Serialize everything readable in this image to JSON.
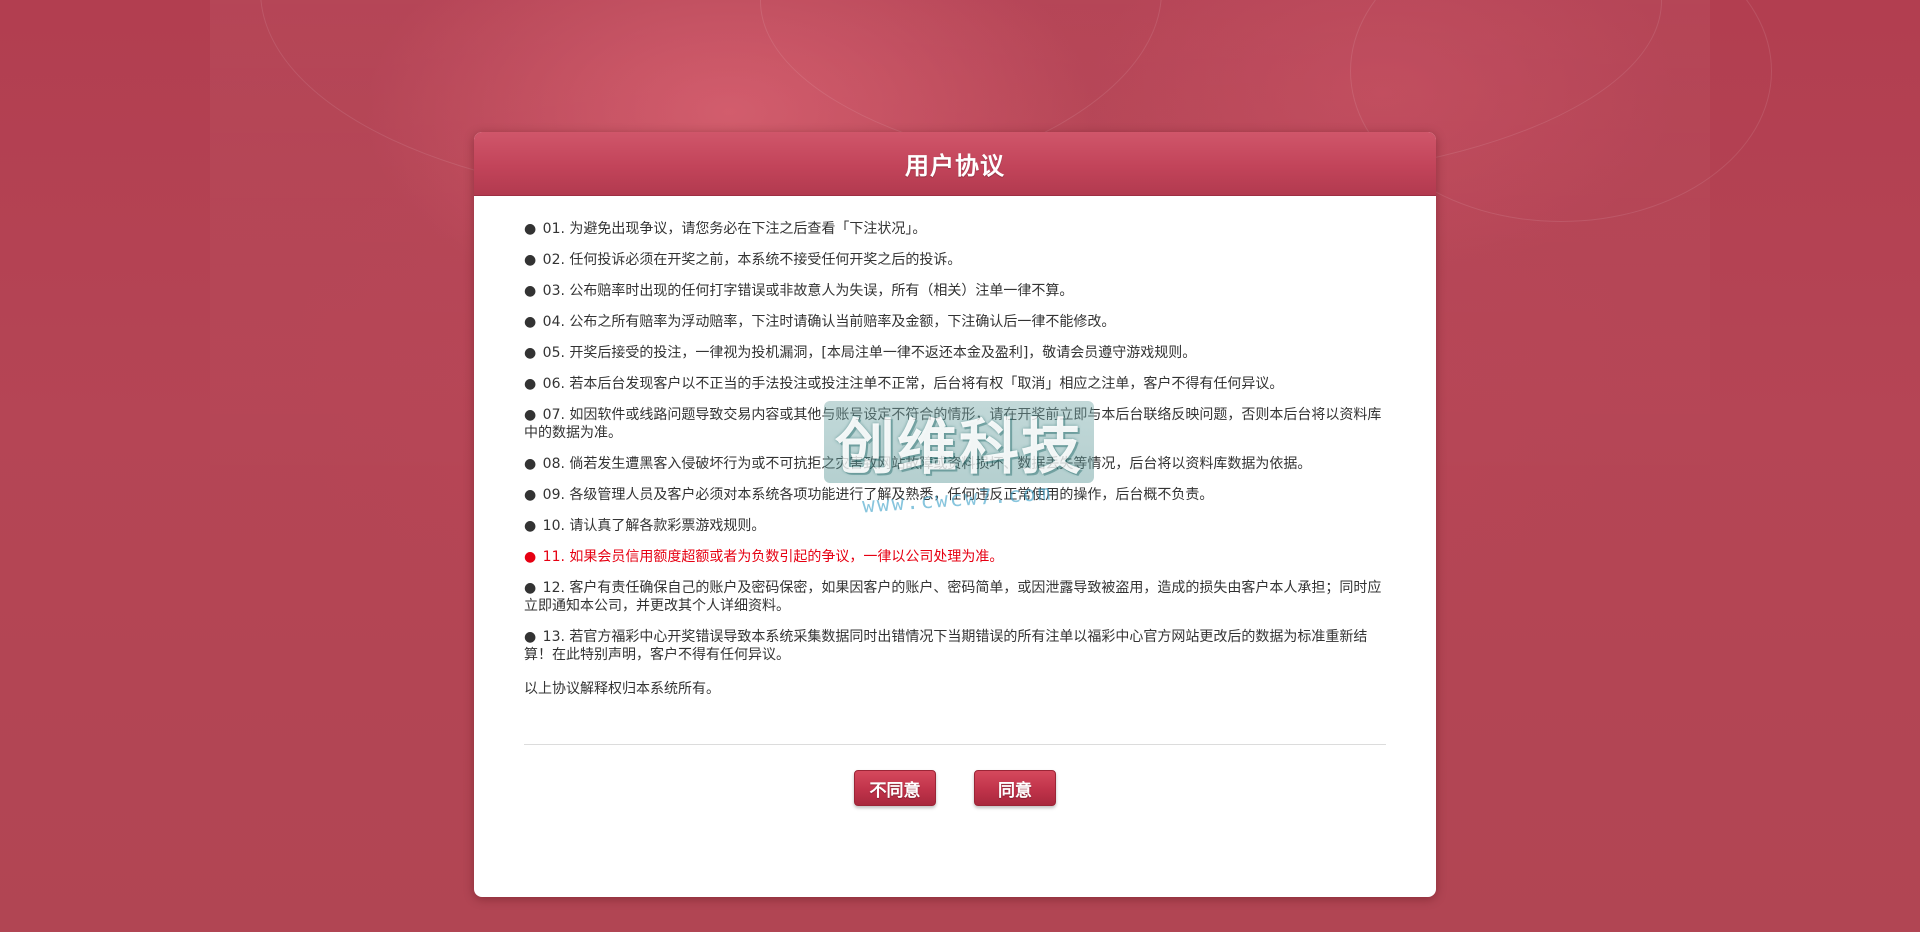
{
  "dialog": {
    "title": "用户协议"
  },
  "terms": [
    {
      "bullet": "●",
      "text": "01. 为避免出现争议，请您务必在下注之后查看「下注状况」。",
      "highlight": false
    },
    {
      "bullet": "●",
      "text": "02. 任何投诉必须在开奖之前，本系统不接受任何开奖之后的投诉。",
      "highlight": false
    },
    {
      "bullet": "●",
      "text": "03. 公布赔率时出现的任何打字错误或非故意人为失误，所有（相关）注单一律不算。",
      "highlight": false
    },
    {
      "bullet": "●",
      "text": "04. 公布之所有赔率为浮动赔率，下注时请确认当前赔率及金额，下注确认后一律不能修改。",
      "highlight": false
    },
    {
      "bullet": "●",
      "text": "05. 开奖后接受的投注，一律视为投机漏洞，[本局注单一律不返还本金及盈利]，敬请会员遵守游戏规则。",
      "highlight": false
    },
    {
      "bullet": "●",
      "text": "06. 若本后台发现客户以不正当的手法投注或投注注单不正常，后台将有权「取消」相应之注单，客户不得有任何异议。",
      "highlight": false
    },
    {
      "bullet": "●",
      "text": "07. 如因软件或线路问题导致交易内容或其他与账号设定不符合的情形，请在开奖前立即与本后台联络反映问题，否则本后台将以资料库中的数据为准。",
      "highlight": false
    },
    {
      "bullet": "●",
      "text": "08. 倘若发生遭黑客入侵破坏行为或不可抗拒之灾害致网站故障或资料损坏、数据丢失等情况，后台将以资料库数据为依据。",
      "highlight": false
    },
    {
      "bullet": "●",
      "text": "09. 各级管理人员及客户必须对本系统各项功能进行了解及熟悉，任何违反正常使用的操作，后台概不负责。",
      "highlight": false
    },
    {
      "bullet": "●",
      "text": "10. 请认真了解各款彩票游戏规则。",
      "highlight": false
    },
    {
      "bullet": "●",
      "text": "11. 如果会员信用额度超额或者为负数引起的争议，一律以公司处理为准。",
      "highlight": true
    },
    {
      "bullet": "●",
      "text": "12. 客户有责任确保自己的账户及密码保密，如果因客户的账户、密码简单，或因泄露导致被盗用，造成的损失由客户本人承担；同时应立即通知本公司，并更改其个人详细资料。",
      "highlight": false
    },
    {
      "bullet": "●",
      "text": "13. 若官方福彩中心开奖错误导致本系统采集数据同时出错情况下当期错误的所有注单以福彩中心官方网站更改后的数据为标准重新结算！在此特别声明，客户不得有任何异议。",
      "highlight": false
    }
  ],
  "footer_note": "以上协议解释权归本系统所有。",
  "buttons": {
    "disagree": "不同意",
    "agree": "同意"
  },
  "watermark": {
    "main": "创维科技",
    "url": "www.cwcw7.com"
  },
  "colors": {
    "header": "#c2445a",
    "button": "#c0334a",
    "highlight_text": "#e60012",
    "background": "#b23e50"
  }
}
